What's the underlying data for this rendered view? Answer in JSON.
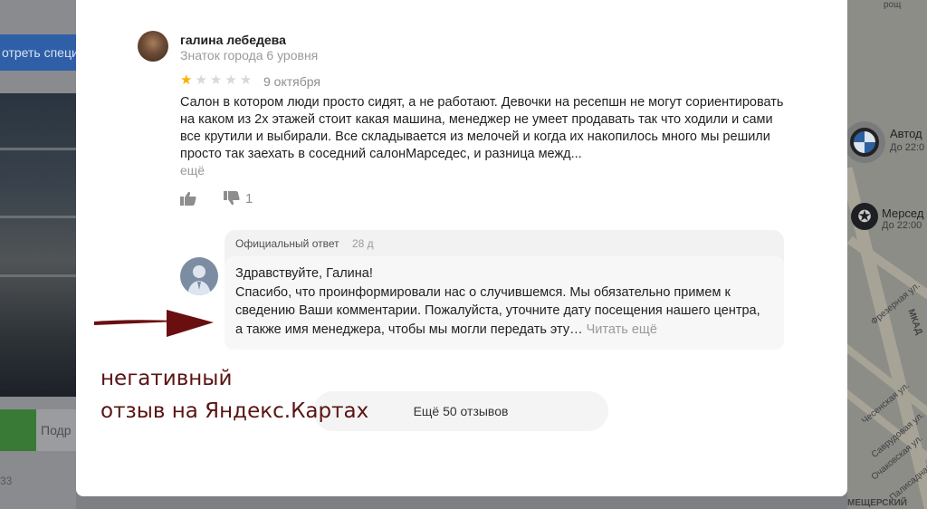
{
  "background_left": {
    "button_label": "отреть специ",
    "green_button_label": "",
    "grey_button_label": "Подр",
    "footer_number": "33"
  },
  "map": {
    "top_label": "рощ\nа",
    "poi_1": {
      "title": "Автод",
      "subtitle": "До 22:0"
    },
    "poi_2": {
      "title": "Мерсед",
      "subtitle": "До 22:00"
    },
    "street_labels": [
      "Фрезерная ул.",
      "МКАД",
      "Чесенская ул.",
      "Саврудовая ул.",
      "Очаковская ул.",
      "Палисадная ул.",
      "МЕЩЕРСКИЙ"
    ]
  },
  "review": {
    "author_name": "галина лебедева",
    "author_level": "Знаток города 6 уровня",
    "rating": 1,
    "rating_max": 5,
    "date": "9 октября",
    "text": "Салон в котором люди просто сидят, а не работают. Девочки на ресепшн не могут сориентировать на каком из 2х этажей стоит какая машина, менеджер не умеет продавать так что ходили и сами все крутили и выбирали. Все складывается из мелочей и когда их накопилось много мы решили просто так заехать в соседний салонМарседес, и разница межд...",
    "more_label": "ещё",
    "likes": "",
    "dislikes": "1"
  },
  "official_reply": {
    "header": "Официальный ответ",
    "age": "28 д",
    "greeting": "Здравствуйте, Галина!",
    "text": "Спасибо, что проинформировали нас о случившемся. Мы обязательно примем к сведению Ваши комментарии. Пожалуйста, уточните дату посещения нашего центра, а также имя менеджера, чтобы мы могли передать эту…",
    "read_more": "Читать ещё"
  },
  "show_more_label": "Ещё 50 отзывов",
  "annotation": {
    "line1": "негативный",
    "line2": "отзыв на Яндекс.Картах",
    "color": "#5a1414"
  },
  "colors": {
    "star_on": "#f5b300",
    "star_off": "#d8d8d8",
    "arrow": "#6a0f10"
  }
}
